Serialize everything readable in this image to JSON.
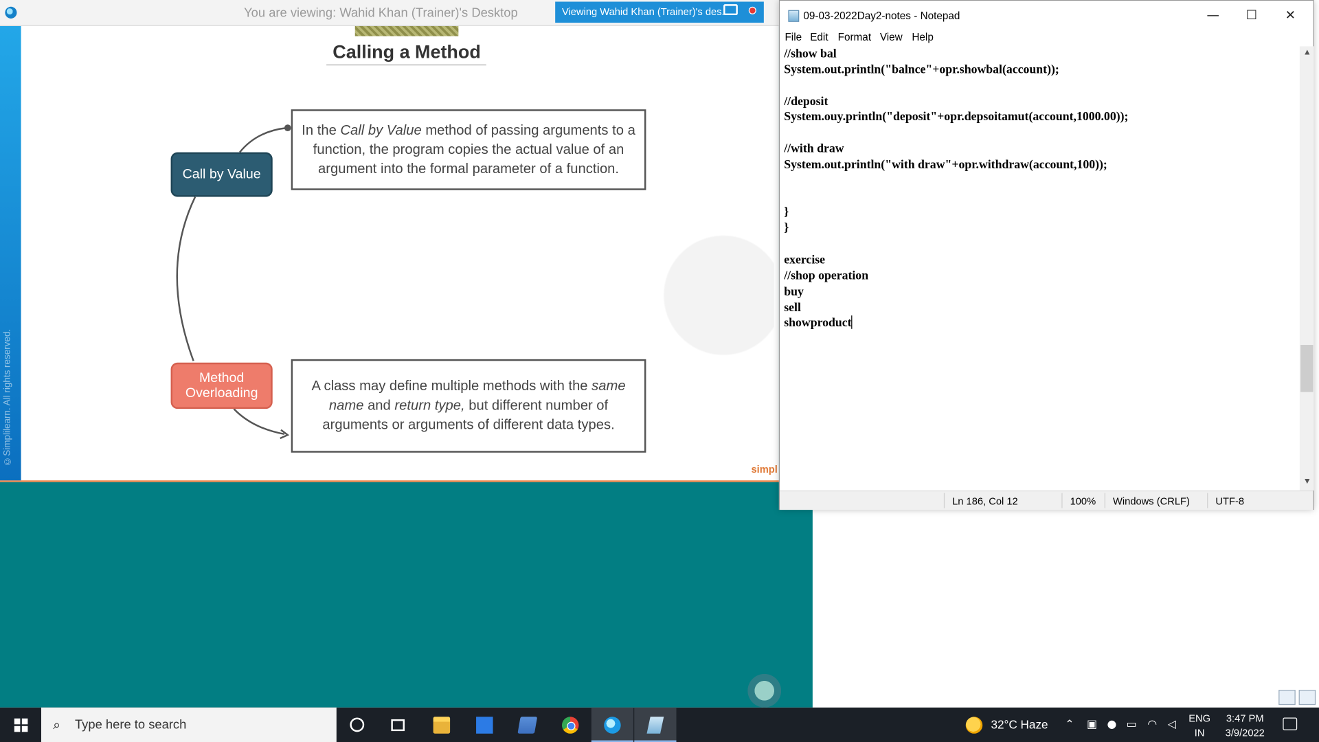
{
  "viewer": {
    "title": "You are viewing: Wahid Khan (Trainer)'s Desktop",
    "badge": "Viewing Wahid Khan (Trainer)'s des..."
  },
  "slide": {
    "title": "Calling a Method",
    "node_cbv": "Call by Value",
    "node_mo_line1": "Method",
    "node_mo_line2": "Overloading",
    "desc_cbv": {
      "p1": "In the ",
      "em1": "Call by Value",
      "p2": " method of passing arguments to a function, the program copies the actual value of an argument into the formal parameter of a function."
    },
    "desc_mo": {
      "p1": "A class may define multiple methods with the ",
      "em1": "same name",
      "p2": " and ",
      "em2": "return type,",
      "p3": " but different number of arguments or arguments of different data types."
    },
    "copyright": "©Simplilearn. All rights reserved.",
    "brand": "simpl"
  },
  "notepad": {
    "title": "09-03-2022Day2-notes - Notepad",
    "menu": [
      "File",
      "Edit",
      "Format",
      "View",
      "Help"
    ],
    "lines": [
      "//show bal",
      "System.out.println(\"balnce\"+opr.showbal(account));",
      "",
      "//deposit",
      "System.ouy.println(\"deposit\"+opr.depsoitamut(account,1000.00));",
      "",
      "//with draw",
      "System.out.println(\"with draw\"+opr.withdraw(account,100));",
      "",
      "",
      "}",
      "}",
      "",
      "exercise",
      "//shop operation",
      "buy",
      "sell",
      "showproduct"
    ],
    "status": {
      "position": "Ln 186, Col 12",
      "zoom": "100%",
      "line_ending": "Windows (CRLF)",
      "encoding": "UTF-8"
    }
  },
  "taskbar": {
    "search_placeholder": "Type here to search",
    "weather": "32°C  Haze",
    "lang_line1": "ENG",
    "lang_line2": "IN",
    "time": "3:47 PM",
    "date": "3/9/2022"
  }
}
